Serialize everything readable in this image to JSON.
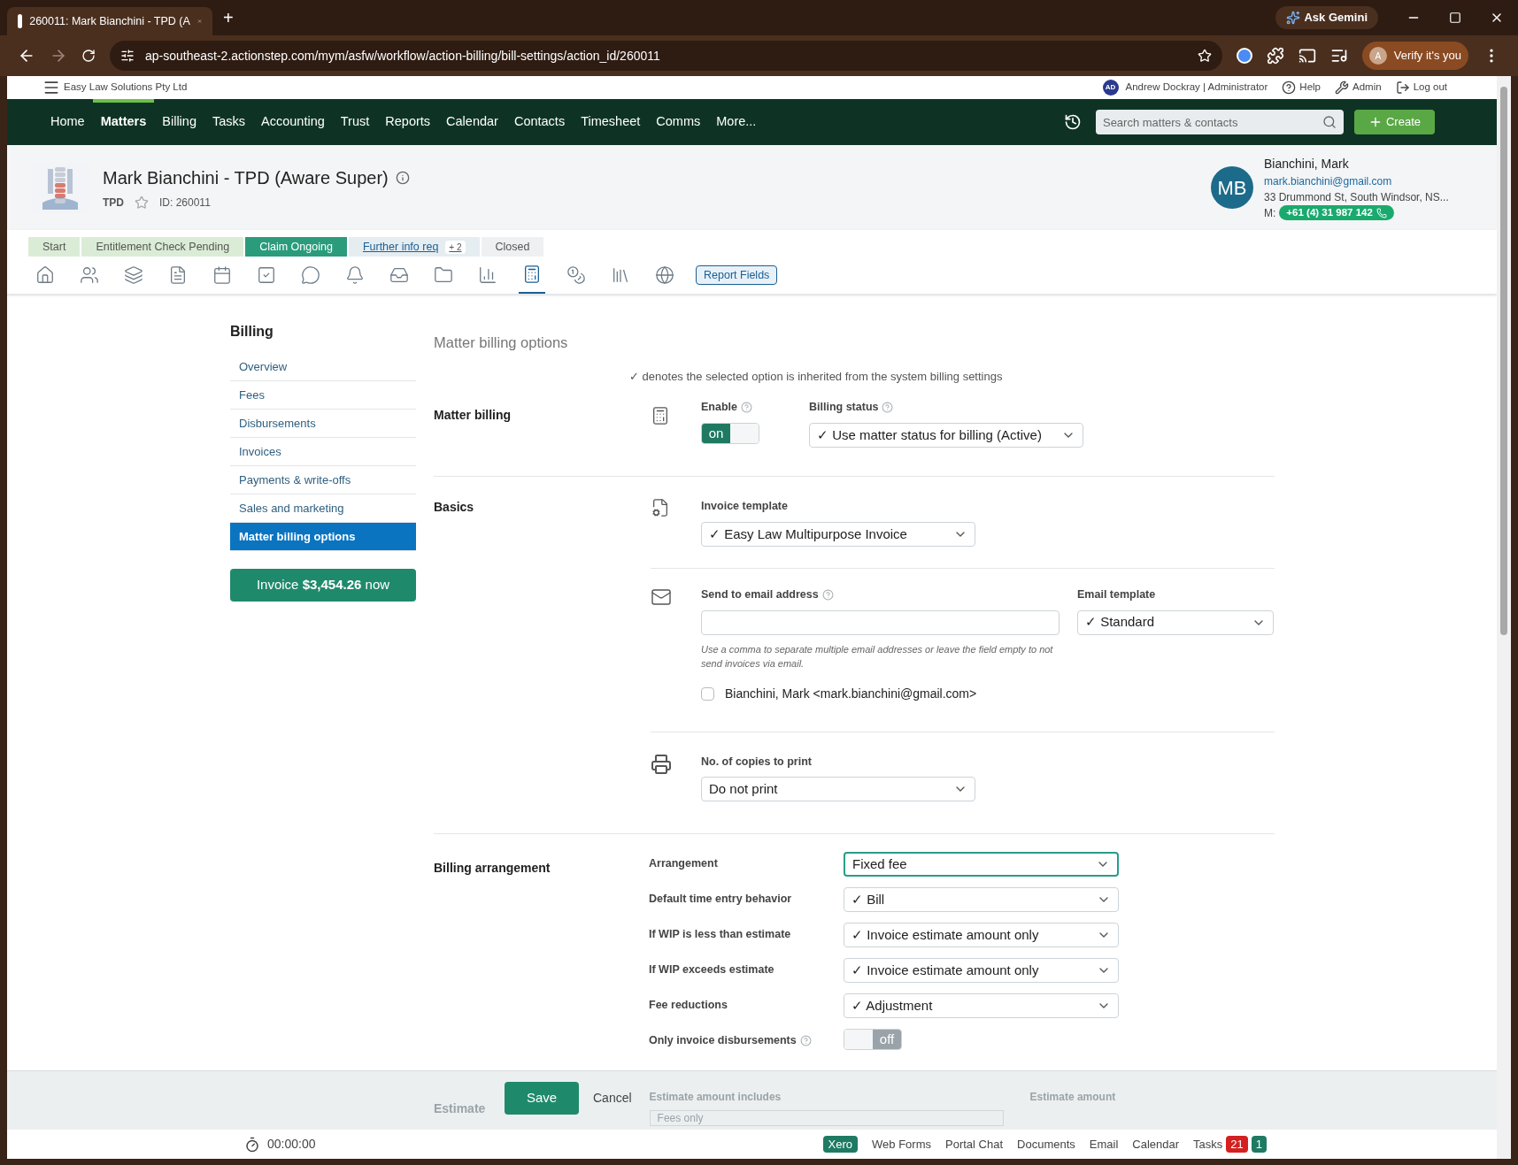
{
  "browser": {
    "tab_title": "260011: Mark Bianchini - TPD (A",
    "new_tab": "+",
    "gemini": "Ask Gemini",
    "url": "ap-southeast-2.actionstep.com/mym/asfw/workflow/action-billing/bill-settings/action_id/260011",
    "profile": "Verify it's you",
    "profile_initial": "A"
  },
  "topbar": {
    "org": "Easy Law Solutions Pty Ltd",
    "user_initials": "AD",
    "user": "Andrew Dockray | Administrator",
    "links": [
      "Help",
      "Admin",
      "Log out"
    ]
  },
  "nav": {
    "items": [
      {
        "label": "Home",
        "selected": false
      },
      {
        "label": "Matters",
        "selected": true
      },
      {
        "label": "Billing",
        "selected": false
      },
      {
        "label": "Tasks",
        "selected": false
      },
      {
        "label": "Accounting",
        "selected": false
      },
      {
        "label": "Trust",
        "selected": false
      },
      {
        "label": "Reports",
        "selected": false
      },
      {
        "label": "Calendar",
        "selected": false
      },
      {
        "label": "Contacts",
        "selected": false
      },
      {
        "label": "Timesheet",
        "selected": false
      },
      {
        "label": "Comms",
        "selected": false
      },
      {
        "label": "More...",
        "selected": false
      }
    ],
    "search_placeholder": "Search matters & contacts",
    "create": "Create"
  },
  "matter": {
    "title": "Mark Bianchini - TPD (Aware Super)",
    "type": "TPD",
    "starred": false,
    "id": "ID: 260011",
    "contact": {
      "initials": "MB",
      "name": "Bianchini, Mark",
      "email": "mark.bianchini@gmail.com",
      "address": "33 Drummond St, South Windsor, NS...",
      "mobile_label": "M:",
      "mobile": "+61 (4) 31 987 142"
    }
  },
  "stages": [
    {
      "label": "Start",
      "kind": "done"
    },
    {
      "label": "Entitlement Check Pending",
      "kind": "done"
    },
    {
      "label": "Claim Ongoing",
      "kind": "current"
    },
    {
      "label": "Further info req",
      "kind": "next",
      "extra": "+ 2"
    },
    {
      "label": "Closed",
      "kind": "future"
    }
  ],
  "matter_tools": [
    {
      "kind": "home",
      "selected": false
    },
    {
      "kind": "people",
      "selected": false
    },
    {
      "kind": "layers",
      "selected": false
    },
    {
      "kind": "file",
      "selected": false
    },
    {
      "kind": "calendar",
      "selected": false
    },
    {
      "kind": "check",
      "selected": false
    },
    {
      "kind": "chat",
      "selected": false
    },
    {
      "kind": "bell",
      "selected": false
    },
    {
      "kind": "inbox",
      "selected": false
    },
    {
      "kind": "folder",
      "selected": false
    },
    {
      "kind": "chart",
      "selected": false
    },
    {
      "kind": "calculator",
      "selected": true
    },
    {
      "kind": "coins",
      "selected": false
    },
    {
      "kind": "library",
      "selected": false
    },
    {
      "kind": "globe",
      "selected": false
    }
  ],
  "report_fields": "Report Fields",
  "sidebar": {
    "title": "Billing",
    "items": [
      {
        "label": "Overview",
        "selected": false
      },
      {
        "label": "Fees",
        "selected": false
      },
      {
        "label": "Disbursements",
        "selected": false
      },
      {
        "label": "Invoices",
        "selected": false
      },
      {
        "label": "Payments & write-offs",
        "selected": false
      },
      {
        "label": "Sales and marketing",
        "selected": false
      },
      {
        "label": "Matter billing options",
        "selected": true
      }
    ],
    "invoice_button": "Invoice **$3,454.26** now"
  },
  "page_title": "Matter billing options",
  "legend": "✓ denotes the selected option is inherited from the system billing settings",
  "matter_billing": {
    "title": "Matter billing",
    "enable_label": "Enable",
    "enable": {
      "on": true,
      "on_text": "on"
    },
    "status_label": "Billing status",
    "status_value": "✓ Use matter status for billing (Active)"
  },
  "basics": {
    "title": "Basics",
    "template_label": "Invoice template",
    "template_value": "✓ Easy Law Multipurpose Invoice",
    "email_label": "Send to email address",
    "email_hint": "Use a comma to separate multiple email addresses or leave the field empty to not send invoices via email.",
    "email_template_label": "Email template",
    "email_template_value": "✓ Standard",
    "recipients": [
      {
        "label": "Bianchini, Mark <mark.bianchini@gmail.com>",
        "checked": false
      }
    ],
    "copies_label": "No. of copies to print",
    "copies_value": "Do not print"
  },
  "arrangement": {
    "title": "Billing arrangement",
    "rows": [
      {
        "kind": "select",
        "label": "Arrangement",
        "value": "Fixed fee",
        "focused": true
      },
      {
        "kind": "select",
        "label": "Default time entry behavior",
        "value": "✓ Bill",
        "focused": false
      },
      {
        "kind": "select",
        "label": "If WIP is less than estimate",
        "value": "✓ Invoice estimate amount only",
        "focused": false
      },
      {
        "kind": "select",
        "label": "If WIP exceeds estimate",
        "value": "✓ Invoice estimate amount only",
        "focused": false
      },
      {
        "kind": "select",
        "label": "Fee reductions",
        "value": "✓ Adjustment",
        "focused": false
      },
      {
        "kind": "toggle",
        "label": "Only invoice disbursements",
        "on": false,
        "off_text": "off"
      }
    ]
  },
  "estimate": {
    "title": "Estimate",
    "includes_label": "Estimate amount includes",
    "includes_value": "Fees only",
    "amount_label": "Estimate amount"
  },
  "actions": {
    "save": "Save",
    "cancel": "Cancel"
  },
  "footer": {
    "timer": "00:00:00",
    "links": [
      {
        "label": "Xero",
        "kind": "badge"
      },
      {
        "label": "Web Forms",
        "kind": "link"
      },
      {
        "label": "Portal Chat",
        "kind": "link"
      },
      {
        "label": "Documents",
        "kind": "link"
      },
      {
        "label": "Email",
        "kind": "link"
      },
      {
        "label": "Calendar",
        "kind": "link"
      }
    ],
    "tasks": "Tasks",
    "tasks_overdue": "21",
    "tasks_today": "1"
  }
}
